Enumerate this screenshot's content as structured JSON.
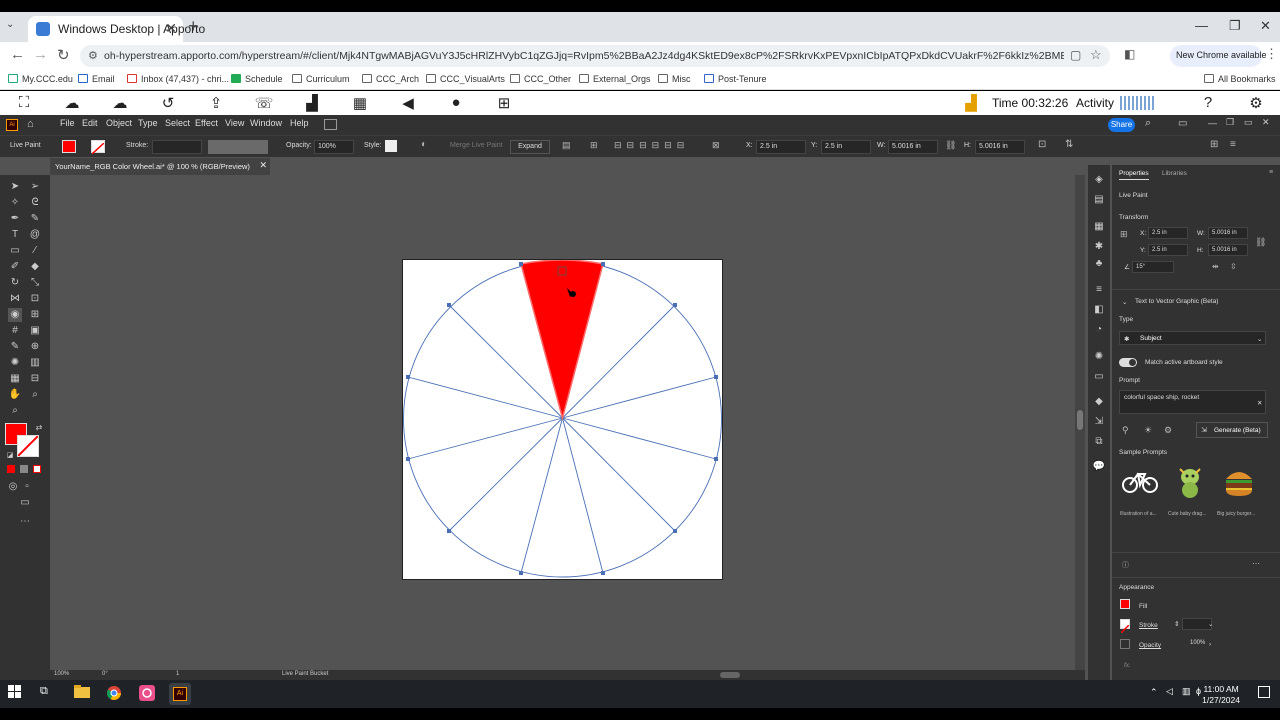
{
  "browser": {
    "tab_title": "Windows Desktop | Apporto",
    "tab_close": "✕",
    "new_tab": "+",
    "url": "oh-hyperstream.apporto.com/hyperstream/#/client/Mjk4NTgwMABjAGVuY3J5cHRlZHVybC1qZGJjq=RvIpm5%2BBaA2Jz4dg4KSktED9ex8cP%2FSRkrvKxPEVpxnICbIpATQPxDkdCVUakrF%2F6kkIz%2BMBjMnRjUaQGlptdkjrGS8fAfoLcz...",
    "chrome_badge": "New Chrome available",
    "all_bookmarks": "All Bookmarks",
    "bookmarks": [
      "My.CCC.edu",
      "Email",
      "Inbox (47,437) - chri...",
      "Schedule",
      "Curriculum",
      "CCC_Arch",
      "CCC_VisualArts",
      "CCC_Other",
      "External_Orgs",
      "Misc",
      "Post-Tenure"
    ]
  },
  "apporto": {
    "time_label": "Time 00:32:26",
    "activity_label": "Activity"
  },
  "illustrator": {
    "menus": [
      "File",
      "Edit",
      "Object",
      "Type",
      "Select",
      "Effect",
      "View",
      "Window",
      "Help"
    ],
    "share_label": "Share",
    "control": {
      "mode": "Live Paint",
      "stroke": "Stroke:",
      "opacity_label": "Opacity:",
      "opacity_value": "100%",
      "style_label": "Style:",
      "merge": "Merge Live Paint",
      "expand": "Expand",
      "x_label": "X:",
      "x_value": "2.5 in",
      "y_label": "Y:",
      "y_value": "2.5 in",
      "w_label": "W:",
      "w_value": "5.0016 in",
      "h_label": "H:",
      "h_value": "5.0016 in"
    },
    "doc_tab": "YourName_RGB Color Wheel.ai* @ 100 % (RGB/Preview)",
    "doc_close": "✕",
    "status": {
      "zoom": "100%",
      "rotate": "0°",
      "artboard": "1",
      "tool": "Live Paint Bucket"
    },
    "colors": {
      "fill": "#ff0000",
      "guide_lines": "#4a6fb5"
    }
  },
  "properties": {
    "tab_properties": "Properties",
    "tab_libraries": "Libraries",
    "object_type": "Live Paint",
    "transform_title": "Transform",
    "x_label": "X:",
    "x_value": "2.5 in",
    "y_label": "Y:",
    "y_value": "2.5 in",
    "w_label": "W:",
    "w_value": "5.0016 in",
    "h_label": "H:",
    "h_value": "5.0016 in",
    "angle_value": "15°",
    "ttv_title": "Text to Vector Graphic (Beta)",
    "type_label": "Type",
    "type_value": "Subject",
    "match_label": "Match active artboard style",
    "prompt_label": "Prompt",
    "prompt_value": "colorful space ship, rocket",
    "generate_label": "Generate (Beta)",
    "samples_label": "Sample Prompts",
    "samples": [
      "Illustration of a...",
      "Cute baby drag...",
      "Big juicy burger..."
    ],
    "appearance_title": "Appearance",
    "fill_label": "Fill",
    "stroke_label": "Stroke",
    "opacity_label": "Opacity",
    "opacity_value": "100%",
    "fx_label": "fx."
  },
  "taskbar": {
    "time": "11:00 AM",
    "date": "1/27/2024"
  }
}
